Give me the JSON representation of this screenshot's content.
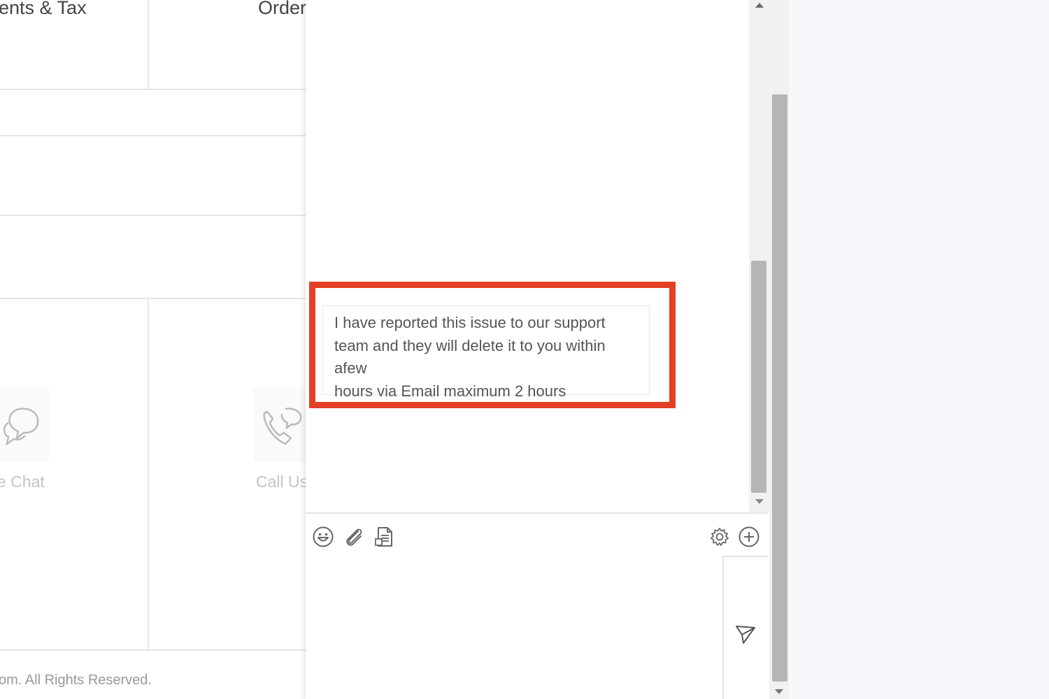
{
  "background_page": {
    "tabs": [
      {
        "label": "ents & Tax"
      },
      {
        "label": "Order"
      }
    ],
    "cards": [
      {
        "label": "e Chat",
        "icon": "chat-bubbles-icon"
      },
      {
        "label": "Call Us",
        "icon": "phone-icon"
      }
    ],
    "footer": "com. All Rights Reserved."
  },
  "chat": {
    "message": {
      "text": "I have reported this issue to our support\nteam  and they will delete it to you within afew\nhours via Email maximum 2 hours"
    },
    "highlight_color": "#e53f25",
    "toolbar": {
      "left_icons": [
        "emoji-icon",
        "attachment-icon",
        "transcript-icon"
      ],
      "right_icons": [
        "settings-icon",
        "add-icon"
      ]
    },
    "input": {
      "value": ""
    },
    "send_icon": "send-icon"
  },
  "colors": {
    "panel_background": "#ffffff",
    "right_background": "#f6f8fb",
    "scroll_thumb": "#b5b5b5"
  }
}
